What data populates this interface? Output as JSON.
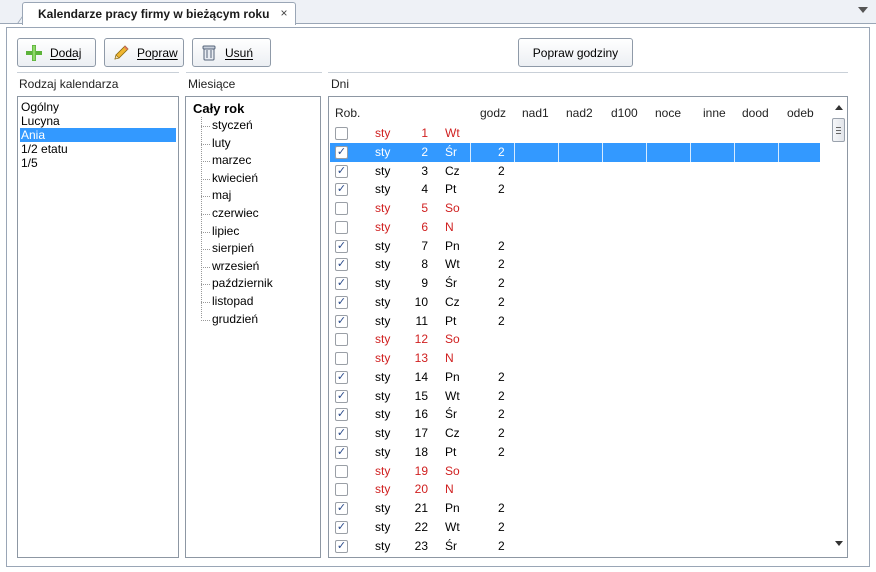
{
  "tab": {
    "title": "Kalendarze pracy firmy w bieżącym roku",
    "close": "×"
  },
  "toolbar": {
    "add_label": "Dodaj",
    "edit_label": "Popraw",
    "delete_label": "Usuń",
    "hours_label": "Popraw godziny"
  },
  "calendar_types": {
    "label": "Rodzaj kalendarza",
    "items": [
      "Ogólny",
      "Lucyna",
      "Ania",
      "1/2 etatu",
      "1/5"
    ],
    "selected": "Ania"
  },
  "months": {
    "label": "Miesiące",
    "root": "Cały rok",
    "items": [
      "styczeń",
      "luty",
      "marzec",
      "kwiecień",
      "maj",
      "czerwiec",
      "lipiec",
      "sierpień",
      "wrzesień",
      "październik",
      "listopad",
      "grudzień"
    ]
  },
  "days": {
    "label": "Dni",
    "columns": [
      "Rob.",
      "godz",
      "nad1",
      "nad2",
      "d100",
      "noce",
      "inne",
      "dood",
      "odeb"
    ],
    "selected_day": "2",
    "rows": [
      {
        "working": false,
        "month": "sty",
        "day": "1",
        "weekday": "Wt",
        "hours": "",
        "holiday": true
      },
      {
        "working": true,
        "month": "sty",
        "day": "2",
        "weekday": "Śr",
        "hours": "2",
        "holiday": false
      },
      {
        "working": true,
        "month": "sty",
        "day": "3",
        "weekday": "Cz",
        "hours": "2",
        "holiday": false
      },
      {
        "working": true,
        "month": "sty",
        "day": "4",
        "weekday": "Pt",
        "hours": "2",
        "holiday": false
      },
      {
        "working": false,
        "month": "sty",
        "day": "5",
        "weekday": "So",
        "hours": "",
        "holiday": true
      },
      {
        "working": false,
        "month": "sty",
        "day": "6",
        "weekday": "N",
        "hours": "",
        "holiday": true
      },
      {
        "working": true,
        "month": "sty",
        "day": "7",
        "weekday": "Pn",
        "hours": "2",
        "holiday": false
      },
      {
        "working": true,
        "month": "sty",
        "day": "8",
        "weekday": "Wt",
        "hours": "2",
        "holiday": false
      },
      {
        "working": true,
        "month": "sty",
        "day": "9",
        "weekday": "Śr",
        "hours": "2",
        "holiday": false
      },
      {
        "working": true,
        "month": "sty",
        "day": "10",
        "weekday": "Cz",
        "hours": "2",
        "holiday": false
      },
      {
        "working": true,
        "month": "sty",
        "day": "11",
        "weekday": "Pt",
        "hours": "2",
        "holiday": false
      },
      {
        "working": false,
        "month": "sty",
        "day": "12",
        "weekday": "So",
        "hours": "",
        "holiday": true
      },
      {
        "working": false,
        "month": "sty",
        "day": "13",
        "weekday": "N",
        "hours": "",
        "holiday": true
      },
      {
        "working": true,
        "month": "sty",
        "day": "14",
        "weekday": "Pn",
        "hours": "2",
        "holiday": false
      },
      {
        "working": true,
        "month": "sty",
        "day": "15",
        "weekday": "Wt",
        "hours": "2",
        "holiday": false
      },
      {
        "working": true,
        "month": "sty",
        "day": "16",
        "weekday": "Śr",
        "hours": "2",
        "holiday": false
      },
      {
        "working": true,
        "month": "sty",
        "day": "17",
        "weekday": "Cz",
        "hours": "2",
        "holiday": false
      },
      {
        "working": true,
        "month": "sty",
        "day": "18",
        "weekday": "Pt",
        "hours": "2",
        "holiday": false
      },
      {
        "working": false,
        "month": "sty",
        "day": "19",
        "weekday": "So",
        "hours": "",
        "holiday": true
      },
      {
        "working": false,
        "month": "sty",
        "day": "20",
        "weekday": "N",
        "hours": "",
        "holiday": true
      },
      {
        "working": true,
        "month": "sty",
        "day": "21",
        "weekday": "Pn",
        "hours": "2",
        "holiday": false
      },
      {
        "working": true,
        "month": "sty",
        "day": "22",
        "weekday": "Wt",
        "hours": "2",
        "holiday": false
      },
      {
        "working": true,
        "month": "sty",
        "day": "23",
        "weekday": "Śr",
        "hours": "2",
        "holiday": false
      }
    ]
  },
  "colors": {
    "selection": "#3399ff",
    "holiday_text": "#d02020",
    "border": "#8d97a3"
  },
  "icons": {
    "add": "plus-icon",
    "edit": "pencil-icon",
    "delete": "trash-icon",
    "menu": "chevron-down-icon"
  }
}
